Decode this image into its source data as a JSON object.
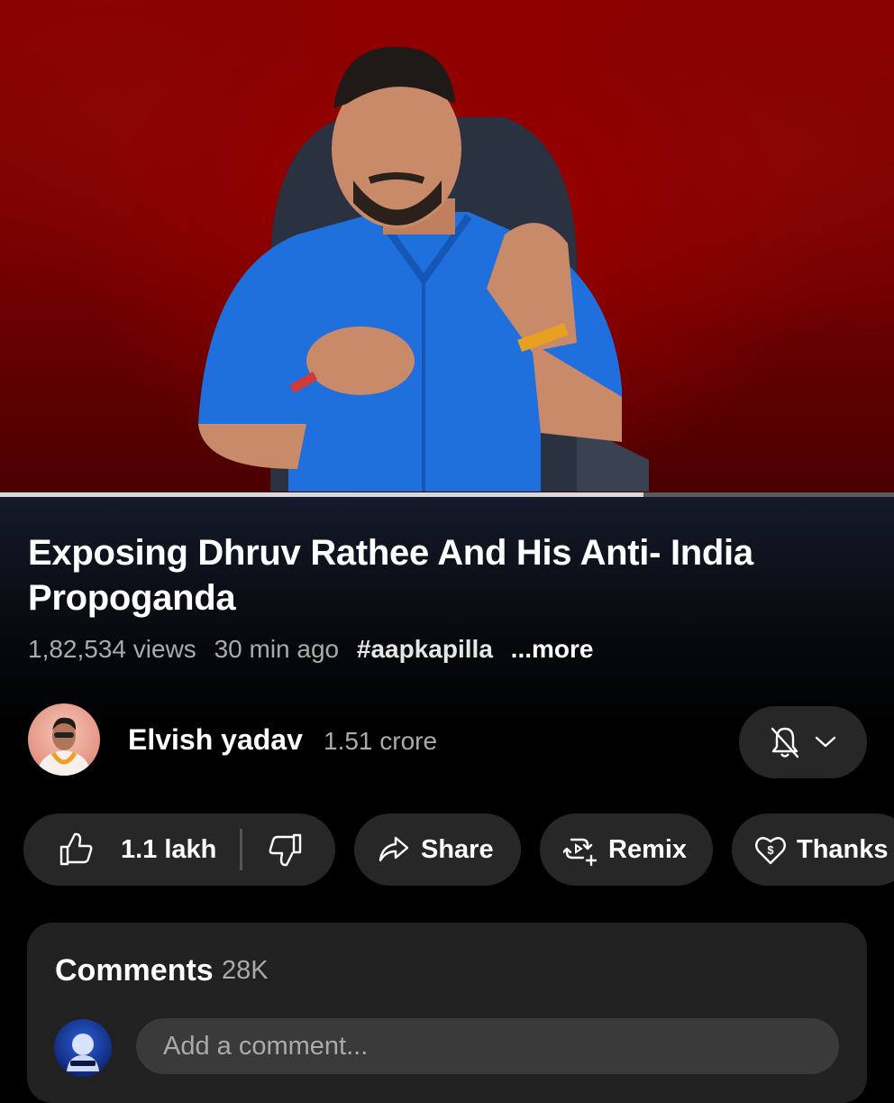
{
  "video": {
    "title": "Exposing Dhruv Rathee And His Anti- India Propoganda",
    "views": "1,82,534 views",
    "time_ago": "30 min ago",
    "hashtag": "#aapkapilla",
    "more_label": "...more",
    "progress": 0.72
  },
  "channel": {
    "name": "Elvish yadav",
    "subscribers": "1.51 crore"
  },
  "actions": {
    "likes": "1.1 lakh",
    "share_label": "Share",
    "remix_label": "Remix",
    "thanks_label": "Thanks"
  },
  "comments": {
    "title": "Comments",
    "count": "28K",
    "placeholder": "Add a comment..."
  },
  "icons": [
    "like-icon",
    "dislike-icon",
    "share-icon",
    "remix-icon",
    "thanks-icon",
    "bell-off-icon",
    "chevron-down-icon"
  ]
}
